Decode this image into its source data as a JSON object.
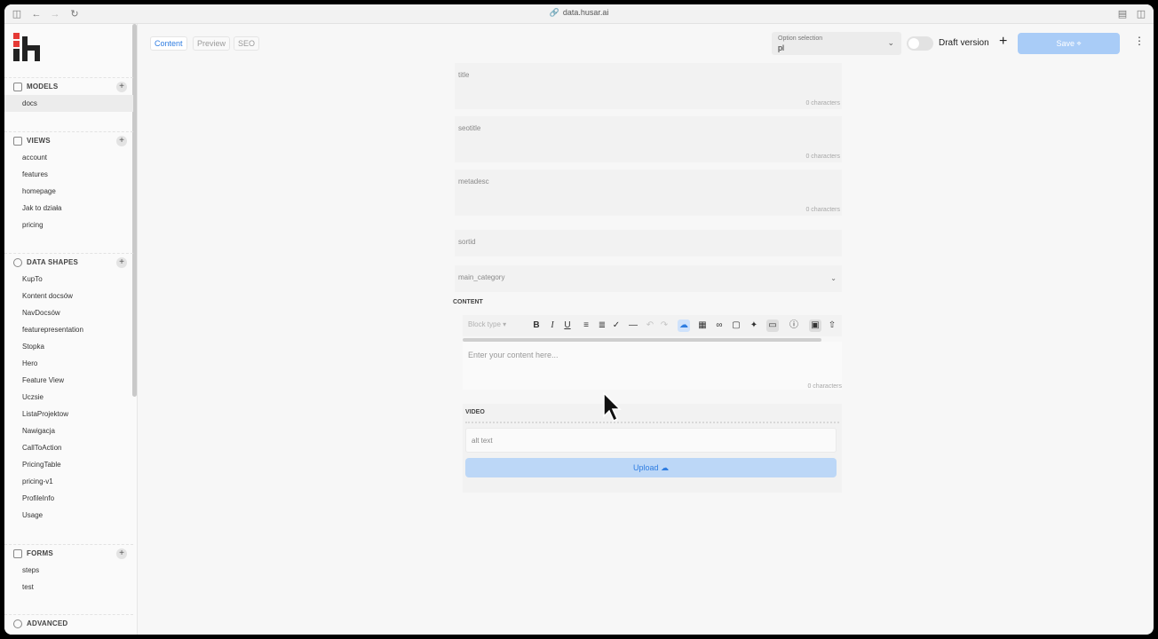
{
  "browser": {
    "url": "data.husar.ai"
  },
  "sidebar": {
    "models": {
      "label": "MODELS",
      "items": [
        "docs"
      ]
    },
    "views": {
      "label": "VIEWS",
      "items": [
        "account",
        "features",
        "homepage",
        "Jak to działa",
        "pricing"
      ]
    },
    "data_shapes": {
      "label": "DATA SHAPES",
      "items": [
        "KupTo",
        "Kontent docsów",
        "NavDocsów",
        "featurepresentation",
        "Stopka",
        "Hero",
        "Feature View",
        "Uczsie",
        "ListaProjektow",
        "Nawigacja",
        "CallToAction",
        "PricingTable",
        "pricing-v1",
        "ProfileInfo",
        "Usage"
      ]
    },
    "forms": {
      "label": "FORMS",
      "items": [
        "steps",
        "test"
      ]
    },
    "advanced": {
      "label": "ADVANCED"
    }
  },
  "toolbar": {
    "tabs": [
      "Content",
      "Preview",
      "SEO"
    ],
    "option_label": "Option selection",
    "option_value": "pl",
    "draft_label": "Draft version",
    "save_label": "Save"
  },
  "form": {
    "title": {
      "label": "title",
      "count": "0 characters"
    },
    "seotitle": {
      "label": "seotitle",
      "count": "0 characters"
    },
    "metadesc": {
      "label": "metadesc",
      "count": "0 characters"
    },
    "sortid": {
      "label": "sortid"
    },
    "main_category": {
      "label": "main_category"
    },
    "content": {
      "label": "CONTENT",
      "block_type": "Block type",
      "placeholder": "Enter your content here...",
      "count": "0 characters"
    },
    "video": {
      "label": "VIDEO",
      "alt_placeholder": "alt text",
      "upload_label": "Upload"
    }
  }
}
